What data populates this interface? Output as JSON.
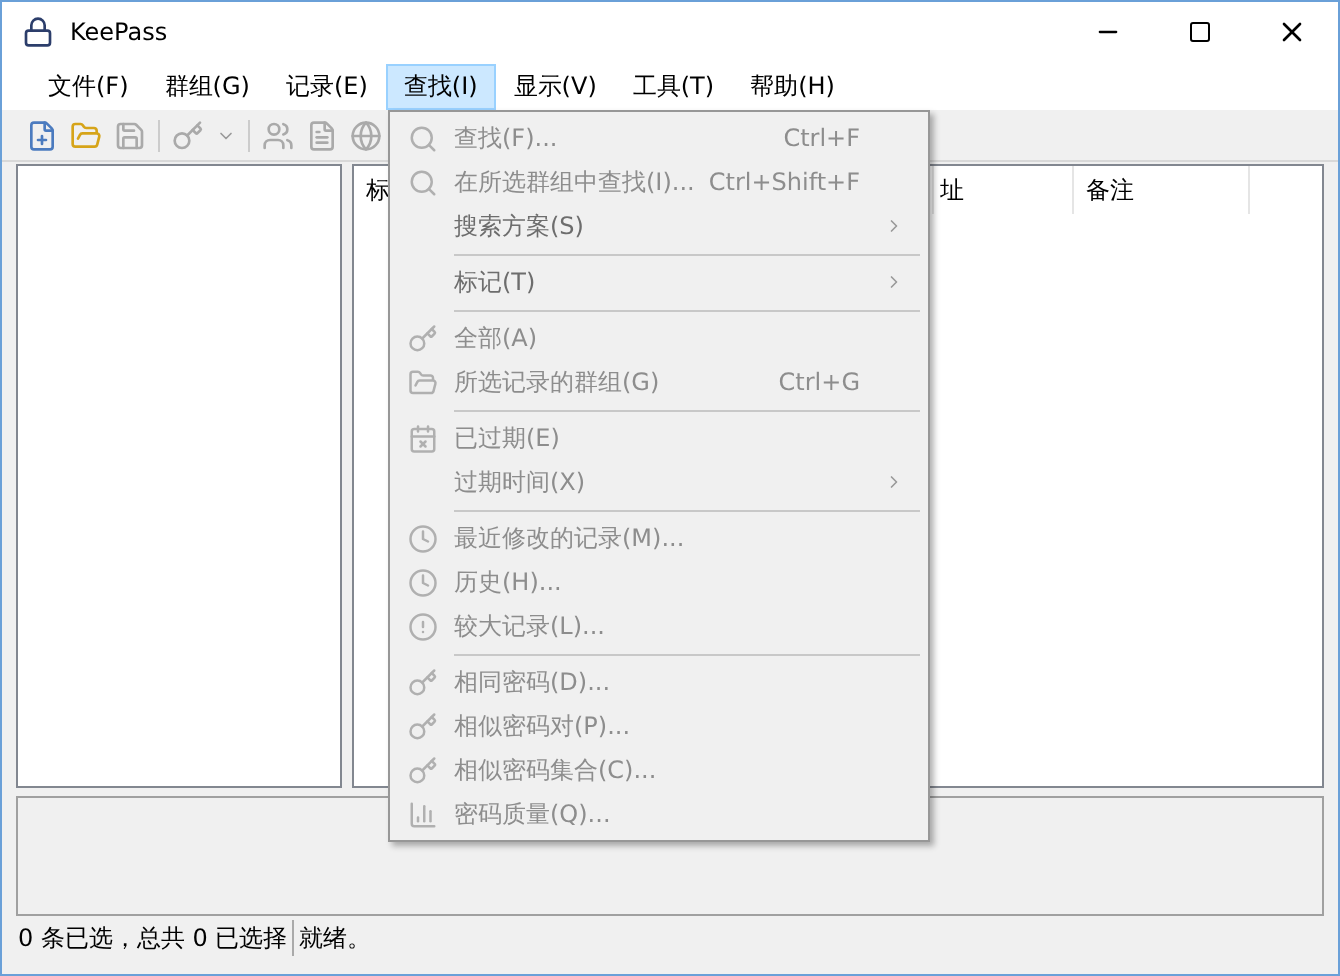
{
  "window": {
    "title": "KeePass"
  },
  "menu_bar": [
    {
      "label": "文件(F)",
      "selected": false
    },
    {
      "label": "群组(G)",
      "selected": false
    },
    {
      "label": "记录(E)",
      "selected": false
    },
    {
      "label": "查找(I)",
      "selected": true
    },
    {
      "label": "显示(V)",
      "selected": false
    },
    {
      "label": "工具(T)",
      "selected": false
    },
    {
      "label": "帮助(H)",
      "selected": false
    }
  ],
  "entry_list": {
    "columns": [
      "标",
      "址",
      "备注"
    ]
  },
  "dropdown_menu": [
    {
      "kind": "item",
      "label": "查找(F)...",
      "shortcut": "Ctrl+F",
      "submenu": false,
      "disabled": true
    },
    {
      "kind": "item",
      "label": "在所选群组中查找(I)...",
      "shortcut": "Ctrl+Shift+F",
      "submenu": false,
      "disabled": true
    },
    {
      "kind": "item",
      "label": "搜索方案(S)",
      "submenu": true,
      "disabled": false
    },
    {
      "kind": "separator"
    },
    {
      "kind": "item",
      "label": "标记(T)",
      "submenu": true,
      "disabled": false
    },
    {
      "kind": "separator"
    },
    {
      "kind": "item",
      "label": "全部(A)",
      "submenu": false,
      "disabled": true
    },
    {
      "kind": "item",
      "label": "所选记录的群组(G)",
      "shortcut": "Ctrl+G",
      "submenu": false,
      "disabled": true
    },
    {
      "kind": "separator"
    },
    {
      "kind": "item",
      "label": "已过期(E)",
      "submenu": false,
      "disabled": true
    },
    {
      "kind": "item",
      "label": "过期时间(X)",
      "submenu": true,
      "disabled": true
    },
    {
      "kind": "separator"
    },
    {
      "kind": "item",
      "label": "最近修改的记录(M)...",
      "submenu": false,
      "disabled": true
    },
    {
      "kind": "item",
      "label": "历史(H)...",
      "submenu": false,
      "disabled": true
    },
    {
      "kind": "item",
      "label": "较大记录(L)...",
      "submenu": false,
      "disabled": true
    },
    {
      "kind": "separator"
    },
    {
      "kind": "item",
      "label": "相同密码(D)...",
      "submenu": false,
      "disabled": true
    },
    {
      "kind": "item",
      "label": "相似密码对(P)...",
      "submenu": false,
      "disabled": true
    },
    {
      "kind": "item",
      "label": "相似密码集合(C)...",
      "submenu": false,
      "disabled": true
    },
    {
      "kind": "item",
      "label": "密码质量(Q)...",
      "submenu": false,
      "disabled": true
    }
  ],
  "status_bar": [
    "0 条已选，总共 0 已选择",
    "就绪。"
  ]
}
